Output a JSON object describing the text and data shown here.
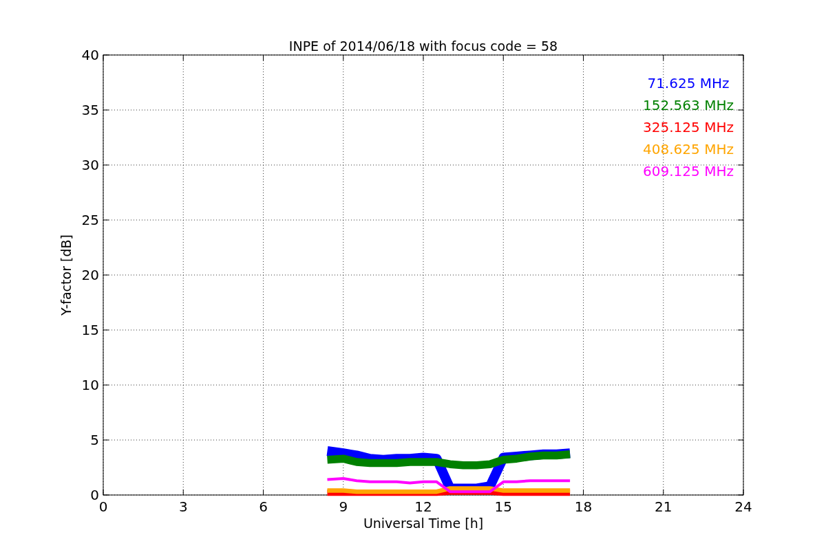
{
  "figure": {
    "chart_data": {
      "type": "line",
      "title": "INPE of 2014/06/18 with focus code = 58",
      "xlabel": "Universal Time [h]",
      "ylabel": "Y-factor [dB]",
      "x": [
        8.4,
        9,
        9.5,
        10,
        10.5,
        11,
        11.5,
        12,
        12.5,
        13,
        13.5,
        14,
        14.5,
        15,
        15.5,
        16,
        16.5,
        17,
        17.5
      ],
      "series": [
        {
          "name": "71.625 MHz",
          "color": "#0000ff",
          "values": [
            4.0,
            3.8,
            3.6,
            3.3,
            3.2,
            3.3,
            3.3,
            3.4,
            3.3,
            0.6,
            0.6,
            0.6,
            0.8,
            3.4,
            3.5,
            3.6,
            3.7,
            3.7,
            3.8
          ]
        },
        {
          "name": "152.563 MHz",
          "color": "#008000",
          "values": [
            3.2,
            3.3,
            3.0,
            2.9,
            2.9,
            2.9,
            3.0,
            3.0,
            3.0,
            2.8,
            2.7,
            2.7,
            2.8,
            3.2,
            3.3,
            3.5,
            3.6,
            3.6,
            3.7
          ]
        },
        {
          "name": "325.125 MHz",
          "color": "#ff0000",
          "values": [
            0.2,
            0.2,
            0.2,
            0.2,
            0.2,
            0.2,
            0.2,
            0.2,
            0.2,
            0.3,
            0.3,
            0.3,
            0.3,
            0.2,
            0.2,
            0.2,
            0.2,
            0.2,
            0.2
          ]
        },
        {
          "name": "408.625 MHz",
          "color": "#ffa500",
          "values": [
            0.4,
            0.4,
            0.3,
            0.3,
            0.3,
            0.3,
            0.3,
            0.3,
            0.3,
            0.6,
            0.6,
            0.6,
            0.6,
            0.4,
            0.4,
            0.4,
            0.4,
            0.4,
            0.4
          ]
        },
        {
          "name": "609.125 MHz",
          "color": "#ff00ff",
          "values": [
            1.4,
            1.5,
            1.3,
            1.2,
            1.2,
            1.2,
            1.1,
            1.2,
            1.2,
            0.3,
            0.3,
            0.3,
            0.3,
            1.2,
            1.2,
            1.3,
            1.3,
            1.3,
            1.3
          ]
        }
      ],
      "grid": true,
      "xlim": [
        0,
        24
      ],
      "ylim": [
        0,
        40
      ],
      "xticks": [
        0,
        3,
        6,
        9,
        12,
        15,
        18,
        21,
        24
      ],
      "yticks": [
        0,
        5,
        10,
        15,
        20,
        25,
        30,
        35,
        40
      ]
    }
  }
}
